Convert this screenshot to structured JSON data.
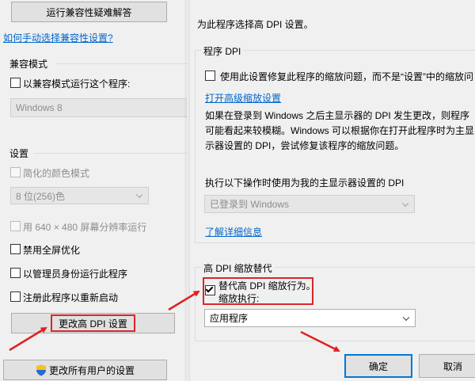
{
  "left": {
    "troubleshoot_button": "运行兼容性疑难解答",
    "manual_link": "如何手动选择兼容性设置?",
    "compat_group_title": "兼容模式",
    "compat_checkbox_label": "以兼容模式运行这个程序:",
    "compat_os_value": "Windows 8",
    "settings_group_title": "设置",
    "reduced_color_label": "简化的颜色模式",
    "color_depth_value": "8 位(256)色",
    "resolution_label": "用 640 × 480 屏幕分辨率运行",
    "fullscreen_opt_label": "禁用全屏优化",
    "admin_label": "以管理员身份运行此程序",
    "restart_label": "注册此程序以重新启动",
    "change_dpi_button": "更改高 DPI 设置",
    "change_all_users_button": "更改所有用户的设置"
  },
  "right": {
    "heading": "为此程序选择高 DPI 设置。",
    "program_dpi_group_title": "程序 DPI",
    "program_dpi_checkbox_label": "使用此设置修复此程序的缩放问题，而不是“设置”中的缩放问",
    "advanced_scaling_link": "打开高级缩放设置",
    "desc_line1": "如果在登录到 Windows 之后主显示器的 DPI 发生更改，则程序",
    "desc_line2": "可能看起来较模糊。Windows 可以根据你在打开此程序时为主显",
    "desc_line3": "示器设置的 DPI，尝试修复该程序的缩放问题。",
    "dpi_source_label": "执行以下操作时使用为我的主显示器设置的 DPI",
    "dpi_source_value": "已登录到 Windows",
    "learn_more_link": "了解详细信息",
    "override_group_title": "高 DPI 缩放替代",
    "override_checkbox_line1": "替代高 DPI 缩放行为。",
    "override_checkbox_line2": "缩放执行:",
    "override_value": "应用程序",
    "ok_button": "确定",
    "cancel_button": "取消"
  },
  "annotations": {
    "highlight_color": "#d9262c",
    "arrow_color": "#e02020"
  },
  "icons": {
    "shield": "uac-shield-icon",
    "check": "checkmark-icon",
    "dropdown": "chevron-down-icon"
  }
}
